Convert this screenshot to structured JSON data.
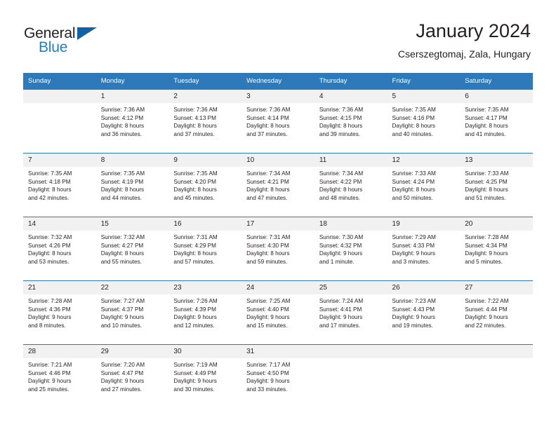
{
  "brand": {
    "name_top": "General",
    "name_bottom": "Blue",
    "color_dark": "#231f20",
    "color_blue": "#1f7fc4",
    "triangle_color": "#1160a8"
  },
  "header": {
    "title": "January 2024",
    "subtitle": "Cserszegtomaj, Zala, Hungary"
  },
  "theme": {
    "header_bg": "#2e79b9",
    "header_text": "#ffffff",
    "daynum_band_bg": "#f1f1f1",
    "grid_line": "#2e79b9",
    "body_text": "#231f20"
  },
  "weekdays": [
    "Sunday",
    "Monday",
    "Tuesday",
    "Wednesday",
    "Thursday",
    "Friday",
    "Saturday"
  ],
  "weeks": [
    [
      {
        "day": "",
        "sunrise": "",
        "sunset": "",
        "daylight_line1": "",
        "daylight_line2": ""
      },
      {
        "day": "1",
        "sunrise": "Sunrise: 7:36 AM",
        "sunset": "Sunset: 4:12 PM",
        "daylight_line1": "Daylight: 8 hours",
        "daylight_line2": "and 36 minutes."
      },
      {
        "day": "2",
        "sunrise": "Sunrise: 7:36 AM",
        "sunset": "Sunset: 4:13 PM",
        "daylight_line1": "Daylight: 8 hours",
        "daylight_line2": "and 37 minutes."
      },
      {
        "day": "3",
        "sunrise": "Sunrise: 7:36 AM",
        "sunset": "Sunset: 4:14 PM",
        "daylight_line1": "Daylight: 8 hours",
        "daylight_line2": "and 37 minutes."
      },
      {
        "day": "4",
        "sunrise": "Sunrise: 7:36 AM",
        "sunset": "Sunset: 4:15 PM",
        "daylight_line1": "Daylight: 8 hours",
        "daylight_line2": "and 39 minutes."
      },
      {
        "day": "5",
        "sunrise": "Sunrise: 7:35 AM",
        "sunset": "Sunset: 4:16 PM",
        "daylight_line1": "Daylight: 8 hours",
        "daylight_line2": "and 40 minutes."
      },
      {
        "day": "6",
        "sunrise": "Sunrise: 7:35 AM",
        "sunset": "Sunset: 4:17 PM",
        "daylight_line1": "Daylight: 8 hours",
        "daylight_line2": "and 41 minutes."
      }
    ],
    [
      {
        "day": "7",
        "sunrise": "Sunrise: 7:35 AM",
        "sunset": "Sunset: 4:18 PM",
        "daylight_line1": "Daylight: 8 hours",
        "daylight_line2": "and 42 minutes."
      },
      {
        "day": "8",
        "sunrise": "Sunrise: 7:35 AM",
        "sunset": "Sunset: 4:19 PM",
        "daylight_line1": "Daylight: 8 hours",
        "daylight_line2": "and 44 minutes."
      },
      {
        "day": "9",
        "sunrise": "Sunrise: 7:35 AM",
        "sunset": "Sunset: 4:20 PM",
        "daylight_line1": "Daylight: 8 hours",
        "daylight_line2": "and 45 minutes."
      },
      {
        "day": "10",
        "sunrise": "Sunrise: 7:34 AM",
        "sunset": "Sunset: 4:21 PM",
        "daylight_line1": "Daylight: 8 hours",
        "daylight_line2": "and 47 minutes."
      },
      {
        "day": "11",
        "sunrise": "Sunrise: 7:34 AM",
        "sunset": "Sunset: 4:22 PM",
        "daylight_line1": "Daylight: 8 hours",
        "daylight_line2": "and 48 minutes."
      },
      {
        "day": "12",
        "sunrise": "Sunrise: 7:33 AM",
        "sunset": "Sunset: 4:24 PM",
        "daylight_line1": "Daylight: 8 hours",
        "daylight_line2": "and 50 minutes."
      },
      {
        "day": "13",
        "sunrise": "Sunrise: 7:33 AM",
        "sunset": "Sunset: 4:25 PM",
        "daylight_line1": "Daylight: 8 hours",
        "daylight_line2": "and 51 minutes."
      }
    ],
    [
      {
        "day": "14",
        "sunrise": "Sunrise: 7:32 AM",
        "sunset": "Sunset: 4:26 PM",
        "daylight_line1": "Daylight: 8 hours",
        "daylight_line2": "and 53 minutes."
      },
      {
        "day": "15",
        "sunrise": "Sunrise: 7:32 AM",
        "sunset": "Sunset: 4:27 PM",
        "daylight_line1": "Daylight: 8 hours",
        "daylight_line2": "and 55 minutes."
      },
      {
        "day": "16",
        "sunrise": "Sunrise: 7:31 AM",
        "sunset": "Sunset: 4:29 PM",
        "daylight_line1": "Daylight: 8 hours",
        "daylight_line2": "and 57 minutes."
      },
      {
        "day": "17",
        "sunrise": "Sunrise: 7:31 AM",
        "sunset": "Sunset: 4:30 PM",
        "daylight_line1": "Daylight: 8 hours",
        "daylight_line2": "and 59 minutes."
      },
      {
        "day": "18",
        "sunrise": "Sunrise: 7:30 AM",
        "sunset": "Sunset: 4:32 PM",
        "daylight_line1": "Daylight: 9 hours",
        "daylight_line2": "and 1 minute."
      },
      {
        "day": "19",
        "sunrise": "Sunrise: 7:29 AM",
        "sunset": "Sunset: 4:33 PM",
        "daylight_line1": "Daylight: 9 hours",
        "daylight_line2": "and 3 minutes."
      },
      {
        "day": "20",
        "sunrise": "Sunrise: 7:28 AM",
        "sunset": "Sunset: 4:34 PM",
        "daylight_line1": "Daylight: 9 hours",
        "daylight_line2": "and 5 minutes."
      }
    ],
    [
      {
        "day": "21",
        "sunrise": "Sunrise: 7:28 AM",
        "sunset": "Sunset: 4:36 PM",
        "daylight_line1": "Daylight: 9 hours",
        "daylight_line2": "and 8 minutes."
      },
      {
        "day": "22",
        "sunrise": "Sunrise: 7:27 AM",
        "sunset": "Sunset: 4:37 PM",
        "daylight_line1": "Daylight: 9 hours",
        "daylight_line2": "and 10 minutes."
      },
      {
        "day": "23",
        "sunrise": "Sunrise: 7:26 AM",
        "sunset": "Sunset: 4:39 PM",
        "daylight_line1": "Daylight: 9 hours",
        "daylight_line2": "and 12 minutes."
      },
      {
        "day": "24",
        "sunrise": "Sunrise: 7:25 AM",
        "sunset": "Sunset: 4:40 PM",
        "daylight_line1": "Daylight: 9 hours",
        "daylight_line2": "and 15 minutes."
      },
      {
        "day": "25",
        "sunrise": "Sunrise: 7:24 AM",
        "sunset": "Sunset: 4:41 PM",
        "daylight_line1": "Daylight: 9 hours",
        "daylight_line2": "and 17 minutes."
      },
      {
        "day": "26",
        "sunrise": "Sunrise: 7:23 AM",
        "sunset": "Sunset: 4:43 PM",
        "daylight_line1": "Daylight: 9 hours",
        "daylight_line2": "and 19 minutes."
      },
      {
        "day": "27",
        "sunrise": "Sunrise: 7:22 AM",
        "sunset": "Sunset: 4:44 PM",
        "daylight_line1": "Daylight: 9 hours",
        "daylight_line2": "and 22 minutes."
      }
    ],
    [
      {
        "day": "28",
        "sunrise": "Sunrise: 7:21 AM",
        "sunset": "Sunset: 4:46 PM",
        "daylight_line1": "Daylight: 9 hours",
        "daylight_line2": "and 25 minutes."
      },
      {
        "day": "29",
        "sunrise": "Sunrise: 7:20 AM",
        "sunset": "Sunset: 4:47 PM",
        "daylight_line1": "Daylight: 9 hours",
        "daylight_line2": "and 27 minutes."
      },
      {
        "day": "30",
        "sunrise": "Sunrise: 7:19 AM",
        "sunset": "Sunset: 4:49 PM",
        "daylight_line1": "Daylight: 9 hours",
        "daylight_line2": "and 30 minutes."
      },
      {
        "day": "31",
        "sunrise": "Sunrise: 7:17 AM",
        "sunset": "Sunset: 4:50 PM",
        "daylight_line1": "Daylight: 9 hours",
        "daylight_line2": "and 33 minutes."
      },
      {
        "day": "",
        "sunrise": "",
        "sunset": "",
        "daylight_line1": "",
        "daylight_line2": ""
      },
      {
        "day": "",
        "sunrise": "",
        "sunset": "",
        "daylight_line1": "",
        "daylight_line2": ""
      },
      {
        "day": "",
        "sunrise": "",
        "sunset": "",
        "daylight_line1": "",
        "daylight_line2": ""
      }
    ]
  ]
}
